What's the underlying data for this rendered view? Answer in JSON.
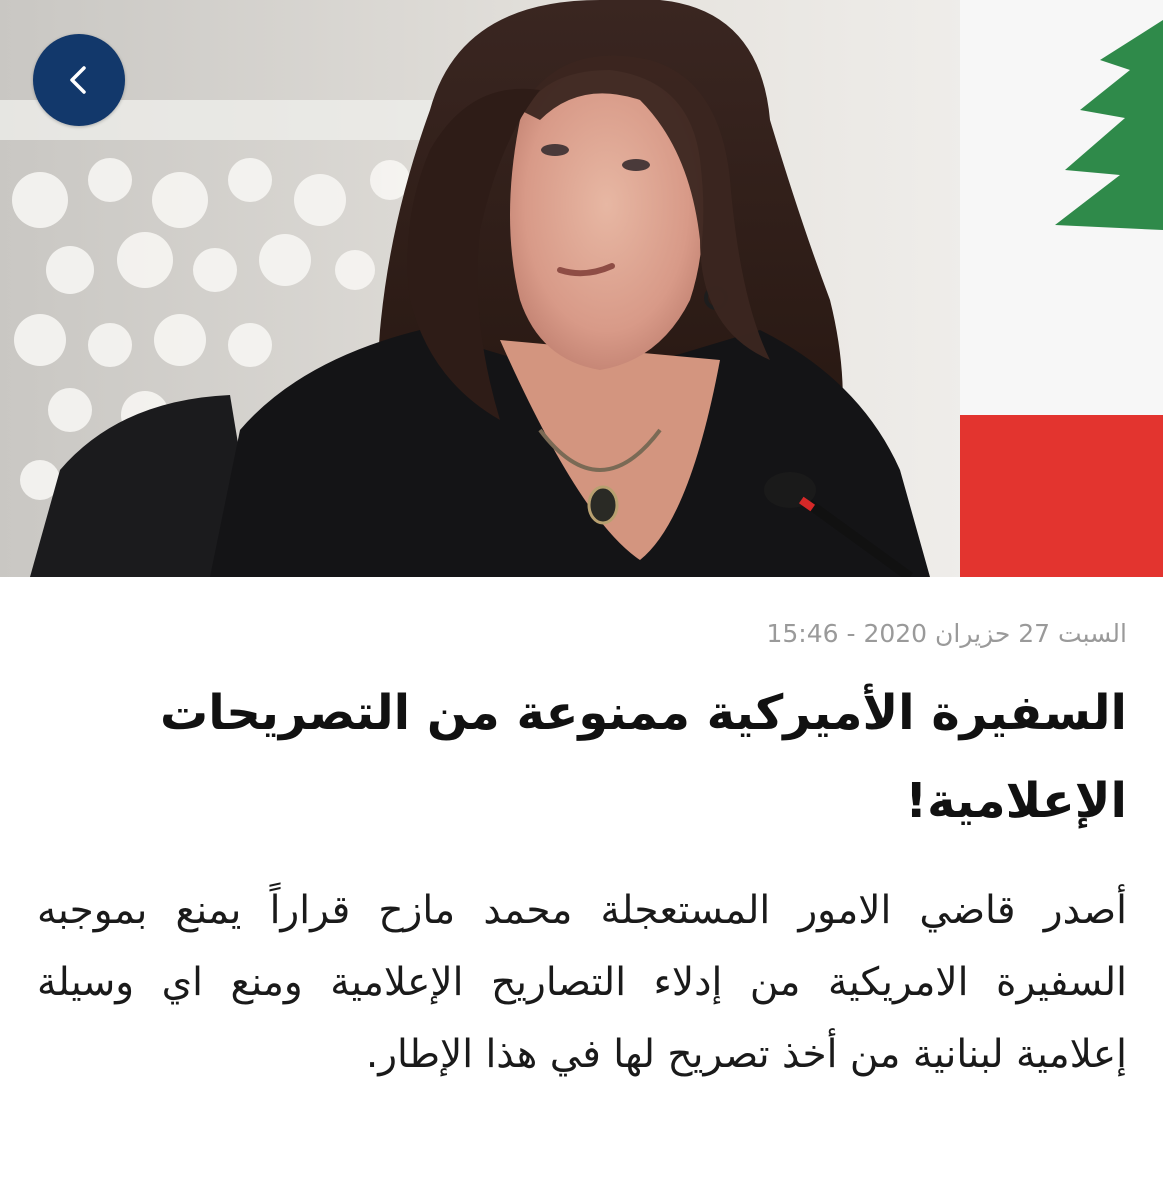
{
  "navigation": {
    "back_icon": "chevron-left-icon",
    "back_button_color": "#12386b"
  },
  "hero_image": {
    "description_icon": "news-photo",
    "accent_colors": {
      "flag_red": "#e3342f",
      "cedar_green": "#2f8a4a"
    }
  },
  "article": {
    "dateline": "السبت 27 حزيران 2020 - 15:46",
    "headline": "السفيرة الأميركية ممنوعة من التصريحات الإعلامية!",
    "body": "أصدر قاضي الامور المستعجلة محمد مازح قراراً يمنع بموجبه السفيرة الامريكية من إدلاء التصاريح الإعلامية ومنع اي وسيلة إعلامية لبنانية من أخذ تصريح لها في هذا الإطار."
  }
}
